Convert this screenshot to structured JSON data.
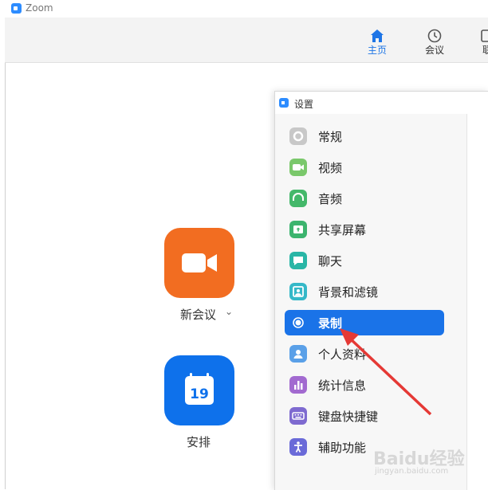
{
  "window": {
    "title": "Zoom"
  },
  "nav": {
    "items": [
      {
        "label": "主页",
        "icon": "home-icon",
        "active": true
      },
      {
        "label": "会议",
        "icon": "clock-icon",
        "active": false
      },
      {
        "label": "联",
        "icon": "contacts-icon",
        "active": false
      }
    ]
  },
  "home": {
    "new_meeting_label": "新会议",
    "schedule_label": "安排",
    "calendar_day": "19"
  },
  "settings": {
    "title": "设置",
    "menu": [
      {
        "label": "常规",
        "icon": "gear-icon",
        "color": "#c8c8c8"
      },
      {
        "label": "视频",
        "icon": "video-icon",
        "color": "#7ac86b"
      },
      {
        "label": "音频",
        "icon": "headphone-icon",
        "color": "#44b86a"
      },
      {
        "label": "共享屏幕",
        "icon": "share-screen-icon",
        "color": "#3cb46e"
      },
      {
        "label": "聊天",
        "icon": "chat-icon",
        "color": "#29b6a6"
      },
      {
        "label": "背景和滤镜",
        "icon": "background-icon",
        "color": "#35b8c8"
      },
      {
        "label": "录制",
        "icon": "record-icon",
        "color": "#1a73e8",
        "active": true
      },
      {
        "label": "个人资料",
        "icon": "profile-icon",
        "color": "#5aa0e8"
      },
      {
        "label": "统计信息",
        "icon": "statistics-icon",
        "color": "#a26ad0"
      },
      {
        "label": "键盘快捷键",
        "icon": "keyboard-icon",
        "color": "#7e6ad0"
      },
      {
        "label": "辅助功能",
        "icon": "accessibility-icon",
        "color": "#6a6ad8"
      }
    ]
  },
  "watermark": {
    "text": "Baidu经验",
    "sub": "jingyan.baidu.com"
  },
  "colors": {
    "accent": "#1a73e8",
    "orange": "#f26d21",
    "blue": "#0e71eb",
    "arrow": "#e53935"
  }
}
